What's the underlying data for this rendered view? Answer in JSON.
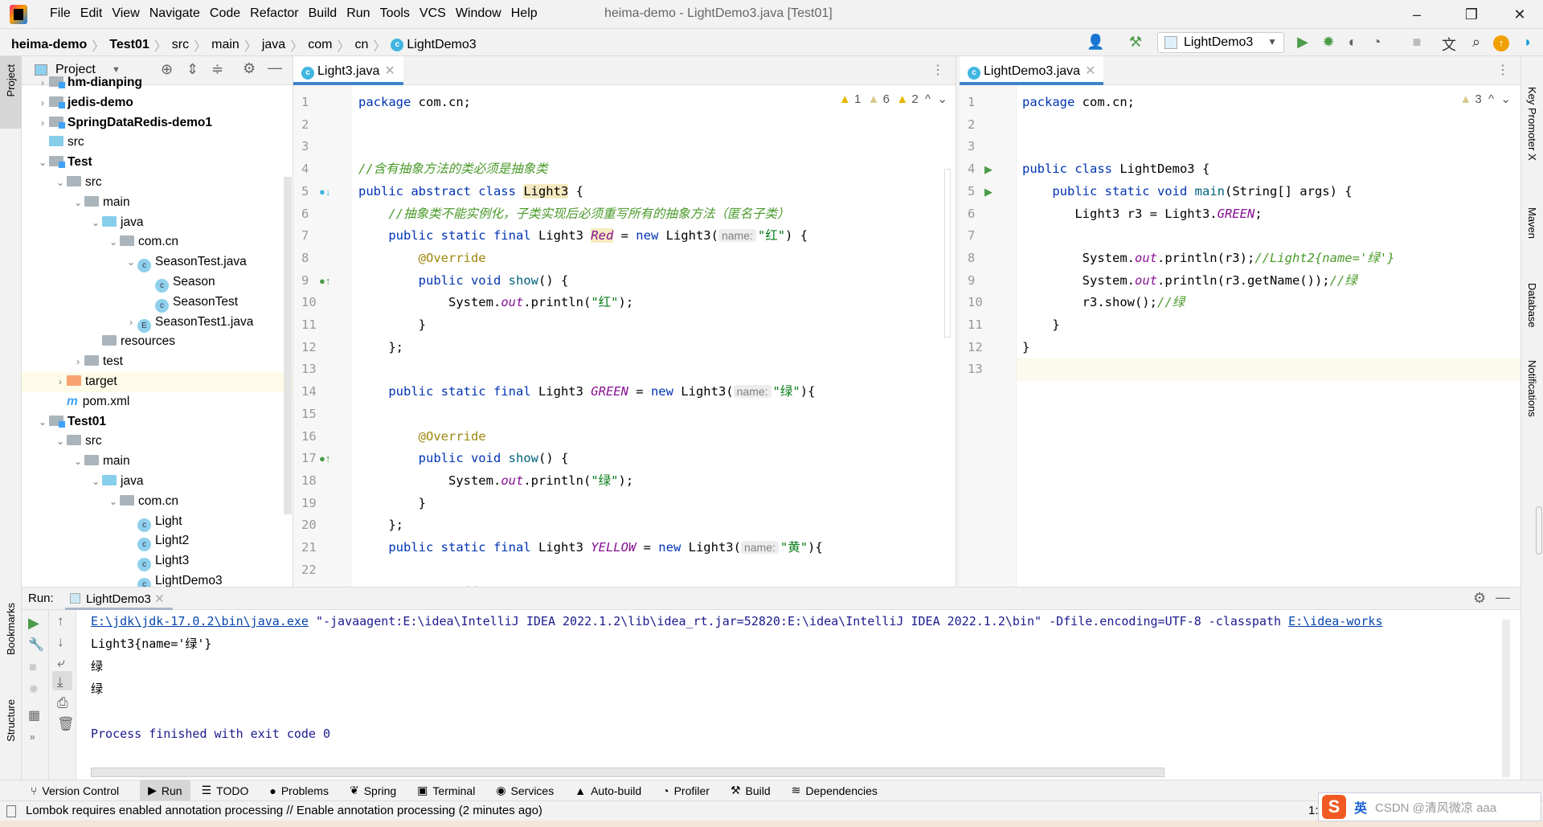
{
  "window": {
    "title": "heima-demo - LightDemo3.java [Test01]",
    "menu": [
      "File",
      "Edit",
      "View",
      "Navigate",
      "Code",
      "Refactor",
      "Build",
      "Run",
      "Tools",
      "VCS",
      "Window",
      "Help"
    ],
    "minimize": "–",
    "restore": "❐",
    "close": "✕"
  },
  "breadcrumb": [
    {
      "label": "heima-demo",
      "bold": true
    },
    {
      "label": "Test01",
      "bold": true
    },
    {
      "label": "src"
    },
    {
      "label": "main"
    },
    {
      "label": "java"
    },
    {
      "label": "com"
    },
    {
      "label": "cn"
    },
    {
      "label": "LightDemo3",
      "icon": "class-icon"
    }
  ],
  "toolbar": {
    "run_config": "LightDemo3"
  },
  "left_stripe": {
    "project": "Project",
    "bookmarks": "Bookmarks",
    "structure": "Structure"
  },
  "right_stripe": [
    "Key Promoter X",
    "Maven",
    "Database",
    "Notifications"
  ],
  "project": {
    "title": "Project",
    "tree": [
      {
        "label": "hm-dianping",
        "level": 1,
        "arrow": ">",
        "icon": "module",
        "bold": true
      },
      {
        "label": "jedis-demo",
        "level": 1,
        "arrow": ">",
        "icon": "module",
        "bold": true
      },
      {
        "label": "SpringDataRedis-demo1",
        "level": 1,
        "arrow": ">",
        "icon": "module",
        "bold": true
      },
      {
        "label": "src",
        "level": 1,
        "arrow": "",
        "icon": "src"
      },
      {
        "label": "Test",
        "level": 1,
        "arrow": "v",
        "icon": "module",
        "bold": true
      },
      {
        "label": "src",
        "level": 2,
        "arrow": "v",
        "icon": "folder"
      },
      {
        "label": "main",
        "level": 3,
        "arrow": "v",
        "icon": "folder"
      },
      {
        "label": "java",
        "level": 4,
        "arrow": "v",
        "icon": "src"
      },
      {
        "label": "com.cn",
        "level": 5,
        "arrow": "v",
        "icon": "package"
      },
      {
        "label": "SeasonTest.java",
        "level": 6,
        "arrow": "v",
        "icon": "class-run"
      },
      {
        "label": "Season",
        "level": 7,
        "arrow": "",
        "icon": "class"
      },
      {
        "label": "SeasonTest",
        "level": 7,
        "arrow": "",
        "icon": "class-run"
      },
      {
        "label": "SeasonTest1.java",
        "level": 6,
        "arrow": ">",
        "icon": "enum"
      },
      {
        "label": "resources",
        "level": 4,
        "arrow": "",
        "icon": "resources"
      },
      {
        "label": "test",
        "level": 3,
        "arrow": ">",
        "icon": "folder"
      },
      {
        "label": "target",
        "level": 2,
        "arrow": ">",
        "icon": "target",
        "selected": true
      },
      {
        "label": "pom.xml",
        "level": 2,
        "arrow": "",
        "icon": "maven"
      },
      {
        "label": "Test01",
        "level": 1,
        "arrow": "v",
        "icon": "module",
        "bold": true
      },
      {
        "label": "src",
        "level": 2,
        "arrow": "v",
        "icon": "folder"
      },
      {
        "label": "main",
        "level": 3,
        "arrow": "v",
        "icon": "folder"
      },
      {
        "label": "java",
        "level": 4,
        "arrow": "v",
        "icon": "src"
      },
      {
        "label": "com.cn",
        "level": 5,
        "arrow": "v",
        "icon": "package"
      },
      {
        "label": "Light",
        "level": 6,
        "arrow": "",
        "icon": "class"
      },
      {
        "label": "Light2",
        "level": 6,
        "arrow": "",
        "icon": "class"
      },
      {
        "label": "Light3",
        "level": 6,
        "arrow": "",
        "icon": "abstract-class"
      },
      {
        "label": "LightDemo3",
        "level": 6,
        "arrow": "",
        "icon": "class-run"
      }
    ]
  },
  "editor_left": {
    "tab": "Light3.java",
    "warnings": [
      {
        "count": "1"
      },
      {
        "count": "6"
      },
      {
        "count": "2"
      }
    ],
    "lines": [
      [
        {
          "t": "package",
          "c": "kw"
        },
        {
          "t": " com.cn;"
        }
      ],
      [],
      [],
      [
        {
          "t": "//含有抽象方法的类必须是抽象类",
          "c": "cm"
        }
      ],
      [
        {
          "t": "public abstract class",
          "c": "kw"
        },
        {
          "t": " "
        },
        {
          "t": "Light3",
          "c": "hl"
        },
        {
          "t": " {"
        }
      ],
      [
        {
          "t": "    "
        },
        {
          "t": "//抽象类不能实例化，子类实现后必须重写所有的抽象方法（匿名子类）",
          "c": "cm"
        }
      ],
      [
        {
          "t": "    "
        },
        {
          "t": "public static final",
          "c": "kw"
        },
        {
          "t": " Light3 "
        },
        {
          "t": "Red",
          "c": "fd hl"
        },
        {
          "t": " = "
        },
        {
          "t": "new",
          "c": "kw"
        },
        {
          "t": " Light3("
        },
        {
          "t": "name:",
          "c": "hint"
        },
        {
          "t": "\"红\"",
          "c": "st"
        },
        {
          "t": ") {"
        }
      ],
      [
        {
          "t": "        "
        },
        {
          "t": "@Override",
          "c": "an"
        }
      ],
      [
        {
          "t": "        "
        },
        {
          "t": "public void",
          "c": "kw"
        },
        {
          "t": " "
        },
        {
          "t": "show",
          "c": "fn"
        },
        {
          "t": "() {"
        }
      ],
      [
        {
          "t": "            System."
        },
        {
          "t": "out",
          "c": "fd"
        },
        {
          "t": ".println("
        },
        {
          "t": "\"红\"",
          "c": "st"
        },
        {
          "t": ");"
        }
      ],
      [
        {
          "t": "        }"
        }
      ],
      [
        {
          "t": "    };"
        }
      ],
      [],
      [
        {
          "t": "    "
        },
        {
          "t": "public static final",
          "c": "kw"
        },
        {
          "t": " Light3 "
        },
        {
          "t": "GREEN",
          "c": "fd"
        },
        {
          "t": " = "
        },
        {
          "t": "new",
          "c": "kw"
        },
        {
          "t": " Light3("
        },
        {
          "t": "name:",
          "c": "hint"
        },
        {
          "t": "\"绿\"",
          "c": "st"
        },
        {
          "t": "){"
        }
      ],
      [],
      [
        {
          "t": "        "
        },
        {
          "t": "@Override",
          "c": "an"
        }
      ],
      [
        {
          "t": "        "
        },
        {
          "t": "public void",
          "c": "kw"
        },
        {
          "t": " "
        },
        {
          "t": "show",
          "c": "fn"
        },
        {
          "t": "() {"
        }
      ],
      [
        {
          "t": "            System."
        },
        {
          "t": "out",
          "c": "fd"
        },
        {
          "t": ".println("
        },
        {
          "t": "\"绿\"",
          "c": "st"
        },
        {
          "t": ");"
        }
      ],
      [
        {
          "t": "        }"
        }
      ],
      [
        {
          "t": "    };"
        }
      ],
      [
        {
          "t": "    "
        },
        {
          "t": "public static final",
          "c": "kw"
        },
        {
          "t": " Light3 "
        },
        {
          "t": "YELLOW",
          "c": "fd"
        },
        {
          "t": " = "
        },
        {
          "t": "new",
          "c": "kw"
        },
        {
          "t": " Light3("
        },
        {
          "t": "name:",
          "c": "hint"
        },
        {
          "t": "\"黄\"",
          "c": "st"
        },
        {
          "t": "){"
        }
      ],
      [],
      [
        {
          "t": "        "
        },
        {
          "t": "@Override",
          "c": "an"
        }
      ]
    ]
  },
  "editor_right": {
    "tab": "LightDemo3.java",
    "warnings": [
      {
        "count": "3"
      }
    ],
    "lines": [
      [
        {
          "t": "package",
          "c": "kw"
        },
        {
          "t": " com.cn;"
        }
      ],
      [],
      [],
      [
        {
          "t": "public class",
          "c": "kw"
        },
        {
          "t": " LightDemo3 {"
        }
      ],
      [
        {
          "t": "    "
        },
        {
          "t": "public static void",
          "c": "kw"
        },
        {
          "t": " "
        },
        {
          "t": "main",
          "c": "fn"
        },
        {
          "t": "(String[] args) {"
        }
      ],
      [
        {
          "t": "       Light3 r3 = Light3."
        },
        {
          "t": "GREEN",
          "c": "fd"
        },
        {
          "t": ";"
        }
      ],
      [],
      [
        {
          "t": "        System."
        },
        {
          "t": "out",
          "c": "fd"
        },
        {
          "t": ".println(r3);"
        },
        {
          "t": "//Light2{name='绿'}",
          "c": "cm"
        }
      ],
      [
        {
          "t": "        System."
        },
        {
          "t": "out",
          "c": "fd"
        },
        {
          "t": ".println(r3.getName());"
        },
        {
          "t": "//绿",
          "c": "cm"
        }
      ],
      [
        {
          "t": "        r3.show();"
        },
        {
          "t": "//绿",
          "c": "cm"
        }
      ],
      [
        {
          "t": "    }"
        }
      ],
      [
        {
          "t": "}"
        }
      ],
      []
    ]
  },
  "run": {
    "label": "Run:",
    "tab": "LightDemo3",
    "output": {
      "cmd_link": "E:\\jdk\\jdk-17.0.2\\bin\\java.exe",
      "cmd_rest": " \"-javaagent:E:\\idea\\IntelliJ IDEA 2022.1.2\\lib\\idea_rt.jar=52820:E:\\idea\\IntelliJ IDEA 2022.1.2\\bin\" -Dfile.encoding=UTF-8 -classpath ",
      "cmd_link2": "E:\\idea-works",
      "lines": [
        "Light3{name='绿'}",
        "绿",
        "绿"
      ],
      "exit": "Process finished with exit code 0"
    }
  },
  "tool_windows": [
    {
      "label": "Version Control",
      "icon": "⑂"
    },
    {
      "label": "Run",
      "icon": "▶",
      "active": true
    },
    {
      "label": "TODO",
      "icon": "☰"
    },
    {
      "label": "Problems",
      "icon": "●"
    },
    {
      "label": "Spring",
      "icon": "❦"
    },
    {
      "label": "Terminal",
      "icon": "▣"
    },
    {
      "label": "Services",
      "icon": "◉"
    },
    {
      "label": "Auto-build",
      "icon": "▲"
    },
    {
      "label": "Profiler",
      "icon": "◔"
    },
    {
      "label": "Build",
      "icon": "⚒"
    },
    {
      "label": "Dependencies",
      "icon": "≋"
    }
  ],
  "status": {
    "message": "Lombok requires enabled annotation processing // Enable annotation processing (2 minutes ago)",
    "position": "1:"
  },
  "ime": {
    "lang": "英",
    "watermark": "CSDN @清风微凉 aaa"
  },
  "colors": {
    "keyword": "#0033b3",
    "string": "#067d17",
    "field": "#871094",
    "accent": "#4083c9"
  }
}
